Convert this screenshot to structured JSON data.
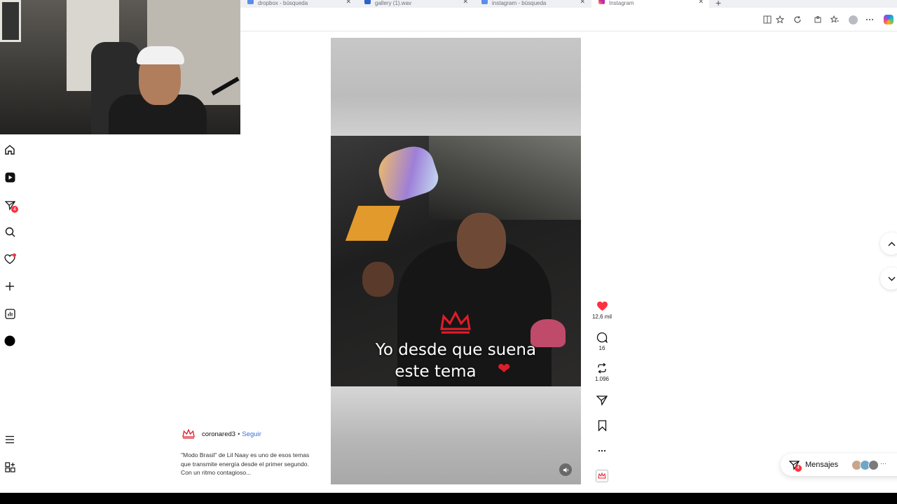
{
  "browser": {
    "tabs": [
      {
        "label": "dropbox - búsqueda"
      },
      {
        "label": "gallery (1).wav"
      },
      {
        "label": "instagram - búsqueda"
      },
      {
        "label": "Instagram"
      }
    ],
    "new_tab": "+",
    "close_glyph": "✕"
  },
  "sidebar": {
    "items": [
      {
        "icon": "home-icon"
      },
      {
        "icon": "reels-icon"
      },
      {
        "icon": "direct-messages-icon",
        "badge": "4"
      },
      {
        "icon": "search-icon"
      },
      {
        "icon": "notifications-icon"
      },
      {
        "icon": "create-icon"
      },
      {
        "icon": "dashboard-icon"
      },
      {
        "icon": "profile-icon"
      },
      {
        "icon": "menu-icon"
      },
      {
        "icon": "more-apps-icon"
      }
    ]
  },
  "reel": {
    "caption_line1": "Yo desde que suena",
    "caption_line2": "este tema",
    "actions": {
      "likes": "12,6 mil",
      "comments": "16",
      "reposts": "1.096"
    },
    "mute_icon": "volume-icon"
  },
  "post": {
    "author": "coronared3",
    "separator": "•",
    "follow_label": "Seguir",
    "description": "\"Modo Brasil\" de Lil Naay es uno de esos temas que transmite energía desde el primer segundo. Con un ritmo contagioso..."
  },
  "messages": {
    "label": "Mensajes",
    "badge": "4",
    "more": "···"
  },
  "colors": {
    "like_red": "#ff3040",
    "link_blue": "#3a6fd8",
    "crown_red": "#e11d2a"
  }
}
